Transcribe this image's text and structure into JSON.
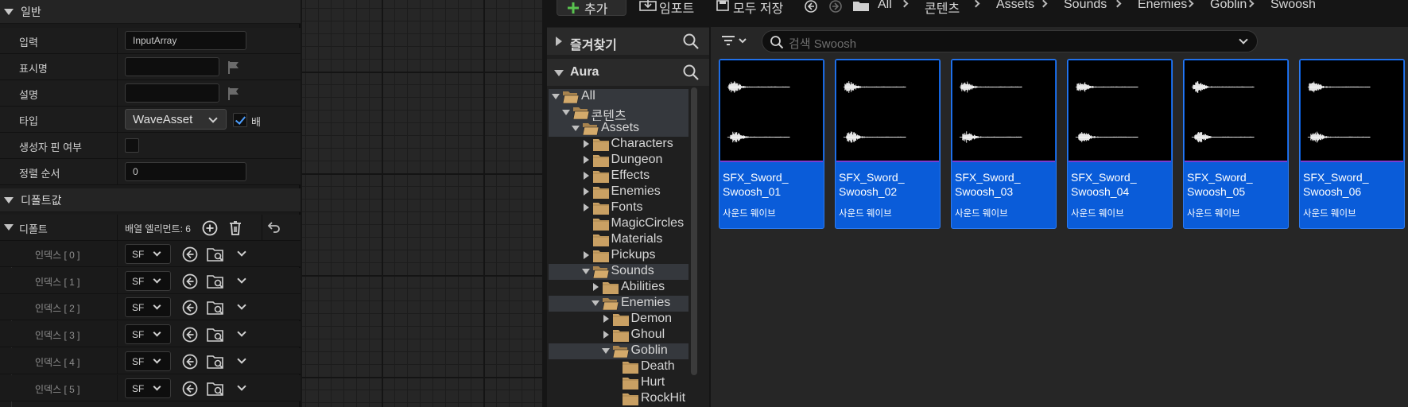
{
  "details": {
    "general": {
      "title": "일반",
      "input_label": "입력",
      "input_value": "InputArray",
      "display_name_label": "표시명",
      "description_label": "설명",
      "type_label": "타입",
      "type_value": "WaveAsset",
      "array_label": "배",
      "constructor_pin_label": "생성자 핀 여부",
      "sort_order_label": "정렬 순서",
      "sort_order_value": "0"
    },
    "defaults": {
      "title": "디폴트값",
      "default_label": "디폴트",
      "array_elements": "배열 엘리먼트: 6",
      "index_rows": [
        {
          "label": "인덱스 [ 0 ]",
          "value": "SF"
        },
        {
          "label": "인덱스 [ 1 ]",
          "value": "SF"
        },
        {
          "label": "인덱스 [ 2 ]",
          "value": "SF"
        },
        {
          "label": "인덱스 [ 3 ]",
          "value": "SF"
        },
        {
          "label": "인덱스 [ 4 ]",
          "value": "SF"
        },
        {
          "label": "인덱스 [ 5 ]",
          "value": "SF"
        }
      ]
    }
  },
  "toolbar": {
    "add_label": "추가",
    "import_label": "임포트",
    "save_all_label": "모두 저장",
    "breadcrumbs": [
      "All",
      "콘텐츠",
      "Assets",
      "Sounds",
      "Enemies",
      "Goblin",
      "Swoosh"
    ]
  },
  "sources": {
    "favorites_label": "즐겨찾기",
    "project_label": "Aura",
    "tree": [
      "All",
      "콘텐츠",
      "Assets",
      "Characters",
      "Dungeon",
      "Effects",
      "Enemies",
      "Fonts",
      "MagicCircles",
      "Materials",
      "Pickups",
      "Sounds",
      "Abilities",
      "Enemies",
      "Demon",
      "Ghoul",
      "Goblin",
      "Death",
      "Hurt",
      "RockHit"
    ]
  },
  "assets": {
    "search_placeholder": "검색 Swoosh",
    "tiles": [
      {
        "name": "SFX_Sword_ Swoosh_01",
        "type": "사운드 웨이브"
      },
      {
        "name": "SFX_Sword_ Swoosh_02",
        "type": "사운드 웨이브"
      },
      {
        "name": "SFX_Sword_ Swoosh_03",
        "type": "사운드 웨이브"
      },
      {
        "name": "SFX_Sword_ Swoosh_04",
        "type": "사운드 웨이브"
      },
      {
        "name": "SFX_Sword_ Swoosh_05",
        "type": "사운드 웨이브"
      },
      {
        "name": "SFX_Sword_ Swoosh_06",
        "type": "사운드 웨이브"
      }
    ]
  },
  "colors": {
    "accent": "#0a5cd9",
    "folder": "#c9a063",
    "panel": "#1a1a1a",
    "selection": "#35383d"
  }
}
